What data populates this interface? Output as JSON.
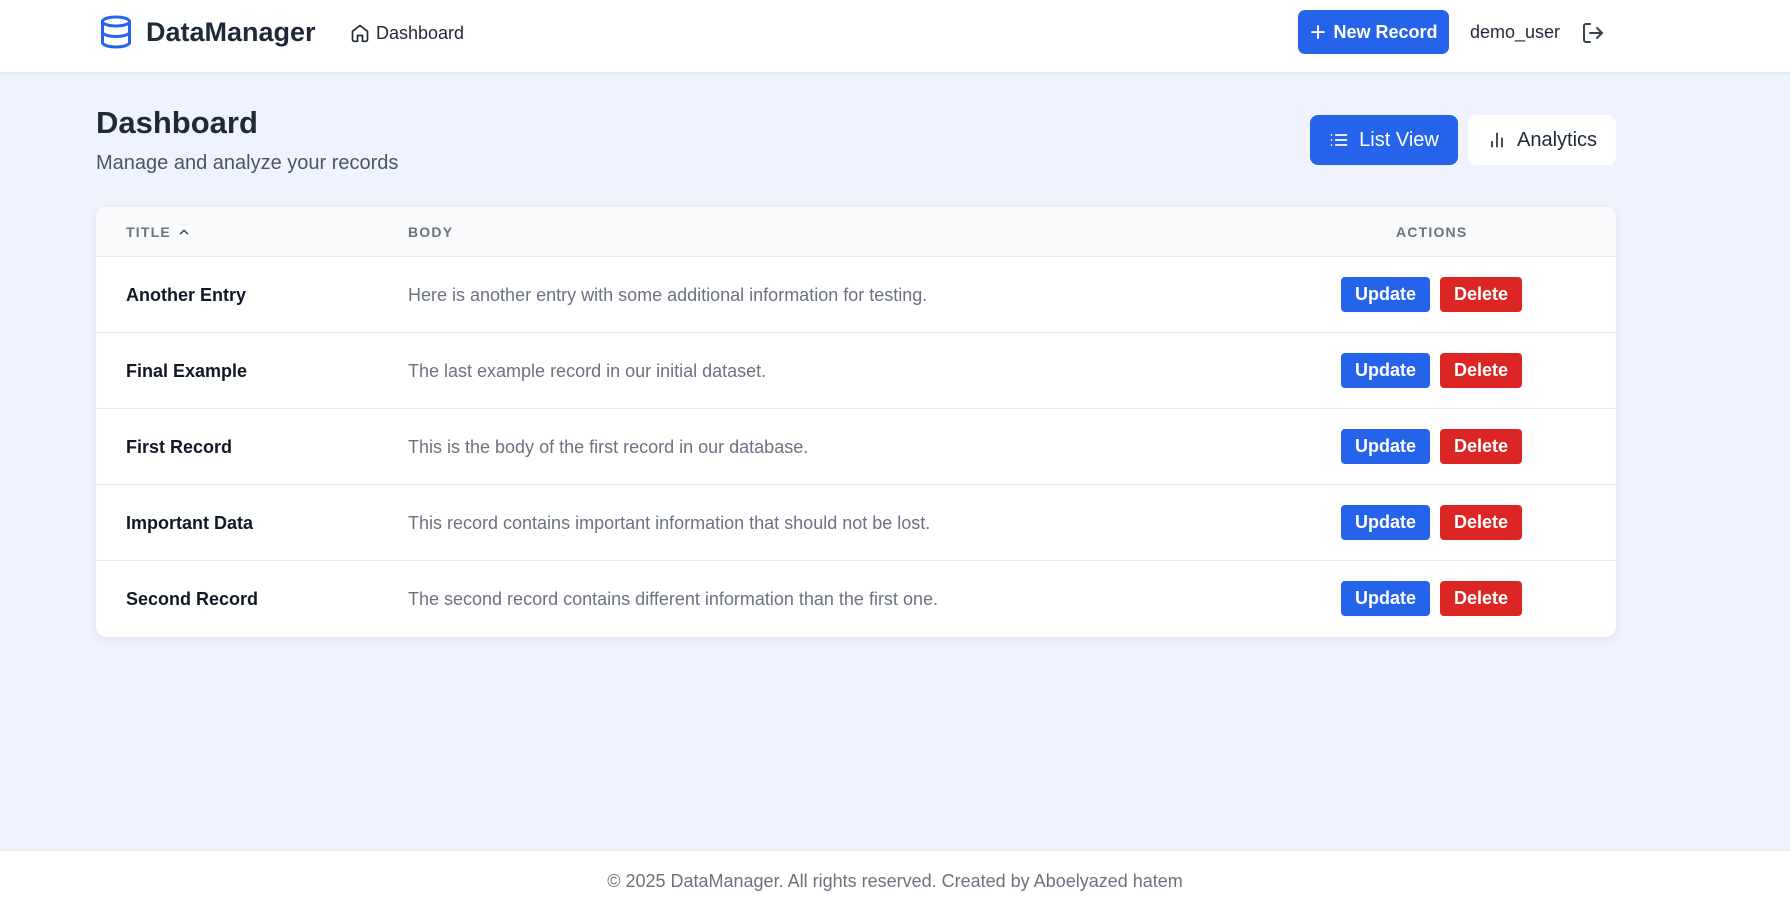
{
  "colors": {
    "primary": "#2563eb",
    "danger": "#dc2626",
    "background": "#eef3fd"
  },
  "navbar": {
    "brand_name": "DataManager",
    "brand_icon": "database-icon",
    "nav_link_label": "Dashboard",
    "nav_link_icon": "home-icon",
    "new_record_label": "New Record",
    "username": "demo_user",
    "logout_icon": "logout-icon"
  },
  "header": {
    "title": "Dashboard",
    "subtitle": "Manage and analyze your records",
    "list_view_label": "List View",
    "analytics_label": "Analytics",
    "active_view": "List View"
  },
  "table": {
    "columns": {
      "title": "TITLE",
      "body": "BODY",
      "actions": "ACTIONS"
    },
    "sort": {
      "column": "TITLE",
      "direction": "ascending"
    },
    "rows": [
      {
        "title": "Another Entry",
        "body": "Here is another entry with some additional information for testing.",
        "update": "Update",
        "delete": "Delete"
      },
      {
        "title": "Final Example",
        "body": "The last example record in our initial dataset.",
        "update": "Update",
        "delete": "Delete"
      },
      {
        "title": "First Record",
        "body": "This is the body of the first record in our database.",
        "update": "Update",
        "delete": "Delete"
      },
      {
        "title": "Important Data",
        "body": "This record contains important information that should not be lost.",
        "update": "Update",
        "delete": "Delete"
      },
      {
        "title": "Second Record",
        "body": "The second record contains different information than the first one.",
        "update": "Update",
        "delete": "Delete"
      }
    ]
  },
  "footer": {
    "text": "© 2025 DataManager. All rights reserved. Created by Aboelyazed hatem"
  }
}
